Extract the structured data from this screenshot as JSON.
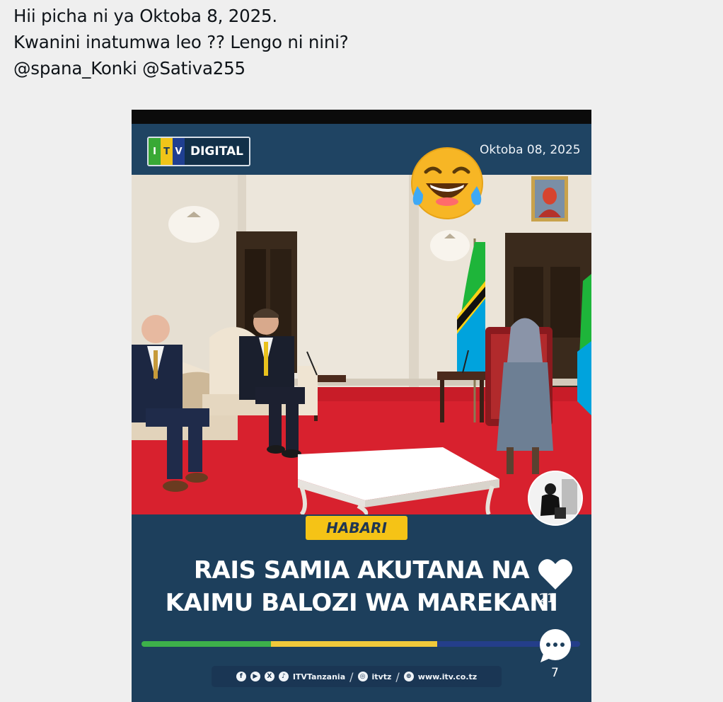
{
  "tweet": {
    "lines": [
      "Hii picha ni ya Oktoba 8, 2025.",
      "Kwanini inatumwa leo ?? Lengo ni nini?",
      "@spana_Konki  @Sativa255"
    ]
  },
  "post": {
    "logo": {
      "i": "I",
      "t": "T",
      "v": "V",
      "label": "DIGITAL"
    },
    "date": "Oktoba 08, 2025",
    "emoji": "face-with-tears-of-joy",
    "badge": "HABARI",
    "headline": [
      "RAIS SAMIA AKUTANA NA",
      "KAIMU BALOZI WA MAREKANI"
    ],
    "footer": {
      "handle_main": "ITVTanzania",
      "handle_ig": "itvtz",
      "website": "www.itv.co.tz"
    },
    "likes": "21",
    "comments": "7",
    "colors": {
      "band": "#1d3f5c",
      "badge": "#f5c316",
      "stripe_green": "#3db14a",
      "stripe_yellow": "#f0c93a",
      "stripe_blue": "#243e8a",
      "carpet": "#d8212e"
    }
  }
}
